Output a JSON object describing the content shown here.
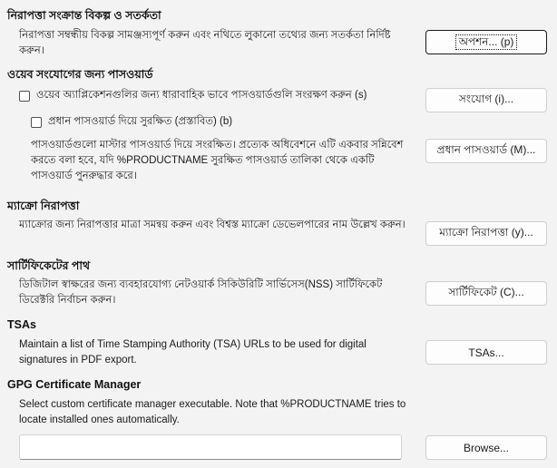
{
  "security": {
    "heading": "নিরাপত্তা সংক্রান্ত বিকল্প ও সতর্কতা",
    "description": "নিরাপত্তা সম্বন্ধীয় বিকল্প সামঞ্জস্যপূর্ণ করুন এবং নথিতে লুকানো তথ্যের জন্য সতর্কতা নির্দিষ্ট করুন।",
    "button": "অপশন... (p)"
  },
  "passwords": {
    "heading": "ওয়েব সংযোগের জন্য পাসওয়ার্ড",
    "persist_checkbox": "ওয়েব অ্যাপ্লিকেশনগুলির জন্য ধারাবাহিক ভাবে পাসওয়ার্ডগুলি সংরক্ষণ করুন (s)",
    "persist_checked": false,
    "connections_button": "সংযোগ (i)...",
    "master_checkbox": "প্রধান পাসওয়ার্ড দিয়ে সুরক্ষিত (প্রস্তাবিত) (b)",
    "master_checked": false,
    "description": "পাসওয়ার্ডগুলো মাস্টার পাসওয়ার্ড দিয়ে সংরক্ষিত। প্রত্যেক অধিবেশনে এটি একবার সন্নিবেশ করতে বলা হবে, যদি %PRODUCTNAME সুরক্ষিত পাসওয়ার্ড তালিকা থেকে একটি পাসওয়ার্ড পুনরুদ্ধার করে।",
    "master_button": "প্রধান পাসওয়ার্ড (M)..."
  },
  "macro": {
    "heading": "ম্যাক্রো নিরাপত্তা",
    "description": "ম্যাক্রোর জন্য নিরাপত্তার মাত্রা সমন্বয় করুন এবং বিশ্বস্ত ম্যাক্রো ডেভেলপারের নাম উল্লেখ করুন।",
    "button": "ম্যাক্রো নিরাপত্তা (y)..."
  },
  "certificate": {
    "heading": "সার্টিফিকেটের পাথ",
    "description": "ডিজিটাল স্বাক্ষরের জন্য ব্যবহারযোগ্য নেটওয়ার্ক সিকিউরিটি সার্ভিসেস(NSS) সার্টিফিকেট ডিরেক্টরি নির্বাচন করুন।",
    "button": "সার্টিফিকেট (C)..."
  },
  "tsa": {
    "heading": "TSAs",
    "description": "Maintain a list of Time Stamping Authority (TSA) URLs to be used for digital signatures in PDF export.",
    "button": "TSAs..."
  },
  "gpg": {
    "heading": "GPG Certificate Manager",
    "description": "Select custom certificate manager executable. Note that %PRODUCTNAME tries to locate installed ones automatically.",
    "path_value": "",
    "button": "Browse..."
  }
}
